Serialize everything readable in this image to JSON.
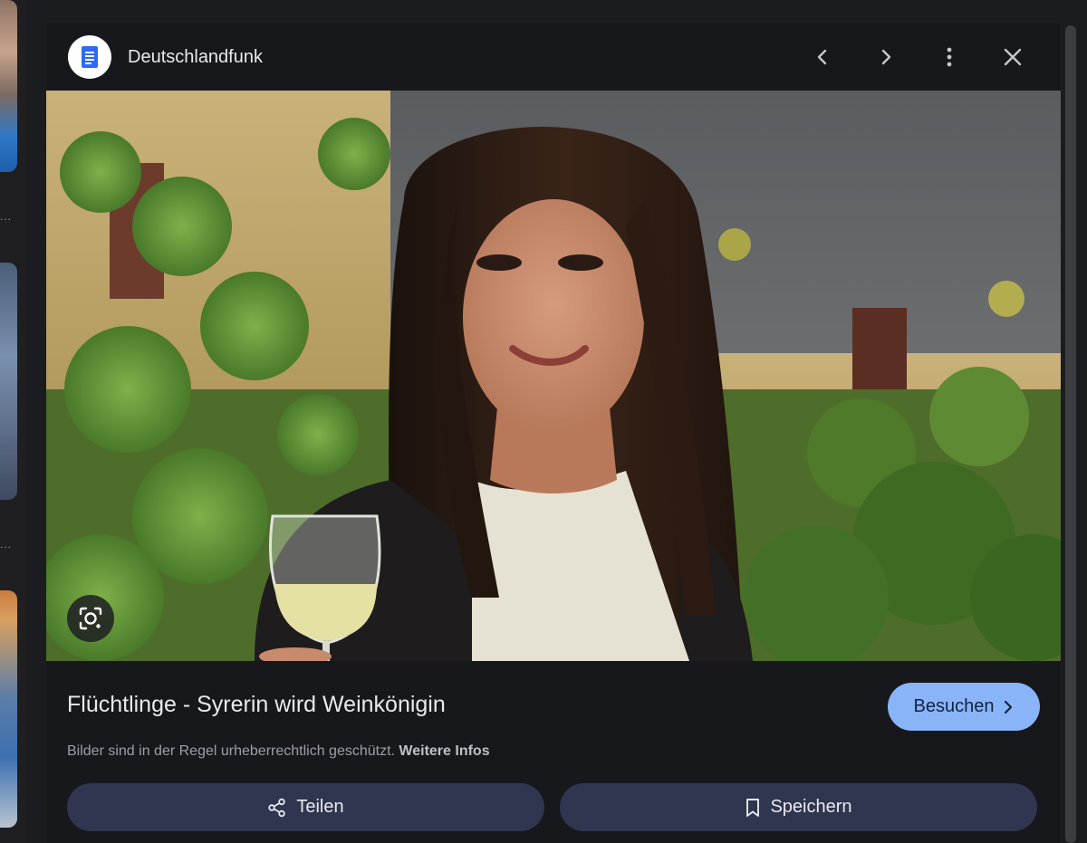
{
  "header": {
    "source_name": "Deutschlandfunk",
    "source_icon": "document-icon",
    "accent": "#2d6cf0",
    "prev_icon": "chevron-left-icon",
    "next_icon": "chevron-right-icon",
    "more_icon": "more-vertical-icon",
    "close_icon": "close-icon"
  },
  "image": {
    "lens_icon": "lens-icon"
  },
  "info": {
    "title": "Flüchtlinge - Syrerin wird Weinkönigin",
    "visit_label": "Besuchen",
    "visit_color": "#8ab4f8",
    "copyright_text": "Bilder sind in der Regel urheberrechtlich geschützt.",
    "more_info_link": "Weitere Infos"
  },
  "actions": {
    "share_label": "Teilen",
    "save_label": "Speichern"
  },
  "background": {
    "thumb_dots": "..."
  }
}
